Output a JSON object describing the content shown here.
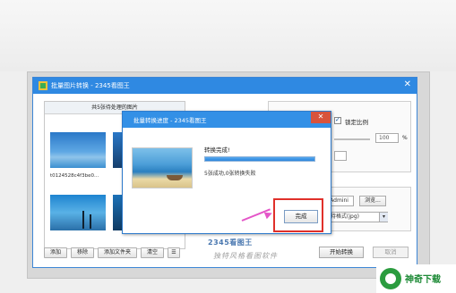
{
  "main_window": {
    "title": "批量图片转换 - 2345看图王",
    "close_glyph": "✕",
    "left_panel": {
      "header": "共5张待处理的图片",
      "file_name": "t0124528c4f3be0...",
      "buttons": [
        "添加",
        "移除",
        "添加文件夹",
        "清空"
      ]
    },
    "right": {
      "lock_ratio_label": "锁定比例",
      "percent_unit": "%",
      "spin_value": "100",
      "path_value": "s\\Admini",
      "browse_label": "浏览...",
      "format_value": "保持格式(jpg)"
    },
    "brand": "2345看图王",
    "watermark": "独特风格看图软件",
    "start_label": "开始转换",
    "cancel_label": "取消"
  },
  "progress_dialog": {
    "title": "批量转换进度 - 2345看图王",
    "close_glyph": "✕",
    "status": "转换完成!",
    "progress": 1.0,
    "result": "5张成功,0张转换失败",
    "done_label": "完成"
  },
  "logo": {
    "text": "神奇下载"
  },
  "colors": {
    "title_bar": "#2f89e2",
    "dialog_title": "#3390e6",
    "close_red": "#d8533c",
    "highlight": "#e0302a",
    "arrow": "#e455c8",
    "logo_green": "#2b9c3f"
  }
}
